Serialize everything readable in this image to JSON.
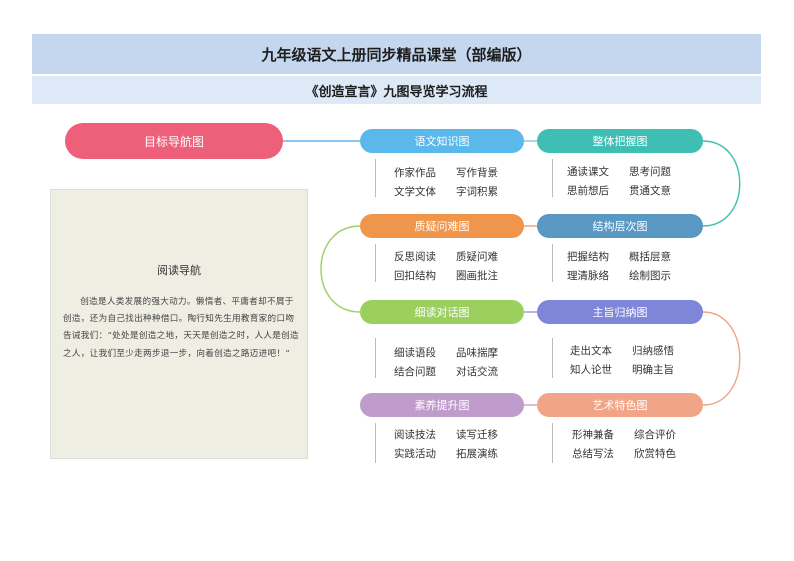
{
  "header": {
    "title": "九年级语文上册同步精品课堂（部编版）",
    "subtitle": "《创造宣言》九图导览学习流程"
  },
  "root": {
    "label": "目标导航图"
  },
  "nodes": [
    {
      "id": "yuwen",
      "label": "语文知识图",
      "color": "#5bb8ea",
      "items": [
        "作家作品",
        "写作背景",
        "文学文体",
        "字词积累"
      ]
    },
    {
      "id": "zhengti",
      "label": "整体把握图",
      "color": "#3fbfb3",
      "items": [
        "通读课文",
        "思考问题",
        "思前想后",
        "贯通文意"
      ]
    },
    {
      "id": "zhiyi",
      "label": "质疑问难图",
      "color": "#f0954c",
      "items": [
        "反思阅读",
        "质疑问难",
        "回扣结构",
        "圈画批注"
      ]
    },
    {
      "id": "jiegou",
      "label": "结构层次图",
      "color": "#5a98c4",
      "items": [
        "把握结构",
        "概括层意",
        "理清脉络",
        "绘制图示"
      ]
    },
    {
      "id": "xidu",
      "label": "细读对话图",
      "color": "#9bd05f",
      "items": [
        "细读语段",
        "品味揣摩",
        "结合问题",
        "对话交流"
      ]
    },
    {
      "id": "zhuzhi",
      "label": "主旨归纳图",
      "color": "#7f86da",
      "items": [
        "走出文本",
        "归纳感悟",
        "知人论世",
        "明确主旨"
      ]
    },
    {
      "id": "suyang",
      "label": "素养提升图",
      "color": "#c09ccc",
      "items": [
        "阅读技法",
        "读写迁移",
        "实践活动",
        "拓展演练"
      ]
    },
    {
      "id": "yishu",
      "label": "艺术特色图",
      "color": "#f1a488",
      "items": [
        "形神兼备",
        "综合评价",
        "总结写法",
        "欣赏特色"
      ]
    }
  ],
  "guide": {
    "title": "阅读导航",
    "body": "创造是人类发展的强大动力。懒惰者、平庸者却不屑于创造，还为自己找出种种借口。陶行知先生用教育家的口吻告诫我们：“处处是创造之地，天天是创造之时，人人是创造之人，让我们至少走两步退一步，向着创造之路迈进吧！”"
  }
}
